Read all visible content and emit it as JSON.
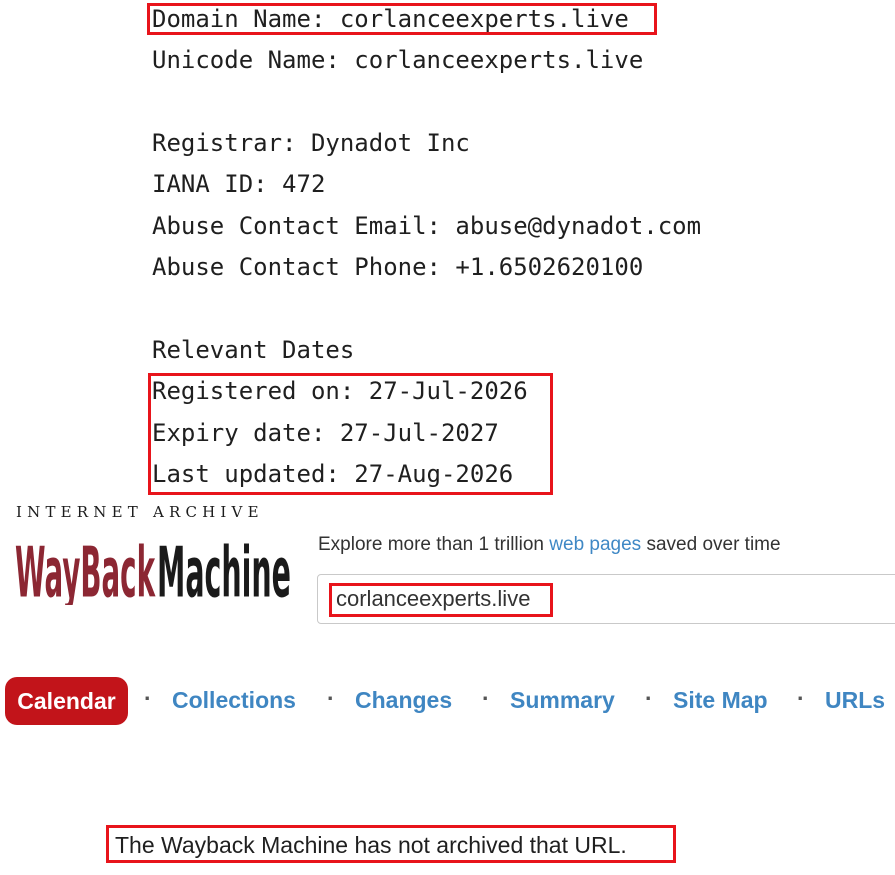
{
  "whois": {
    "domain_name": "Domain Name: corlanceexperts.live",
    "unicode_name": "Unicode Name: corlanceexperts.live",
    "registrar": "Registrar: Dynadot Inc",
    "iana_id": "IANA ID: 472",
    "abuse_email": "Abuse Contact Email: abuse@dynadot.com",
    "abuse_phone": "Abuse Contact Phone: +1.6502620100",
    "dates_heading": "Relevant Dates",
    "registered_on": "Registered on: 27-Jul-2026",
    "expiry_date": "Expiry date: 27-Jul-2027",
    "last_updated": "Last updated: 27-Aug-2026"
  },
  "wayback": {
    "logo_top": "INTERNET ARCHIVE",
    "logo_word": "WayBackMachine",
    "tagline_prefix": "Explore more than 1 trillion ",
    "tagline_link": "web pages",
    "tagline_suffix": " saved over time",
    "search_value": "corlanceexperts.live",
    "nav": {
      "calendar": "Calendar",
      "collections": "Collections",
      "changes": "Changes",
      "summary": "Summary",
      "site_map": "Site Map",
      "urls": "URLs",
      "separator": "·"
    },
    "message": "The Wayback Machine has not archived that URL."
  },
  "colors": {
    "highlight": "#e8141b",
    "brand_red": "#c2141a",
    "link_blue": "#3f86c2"
  }
}
